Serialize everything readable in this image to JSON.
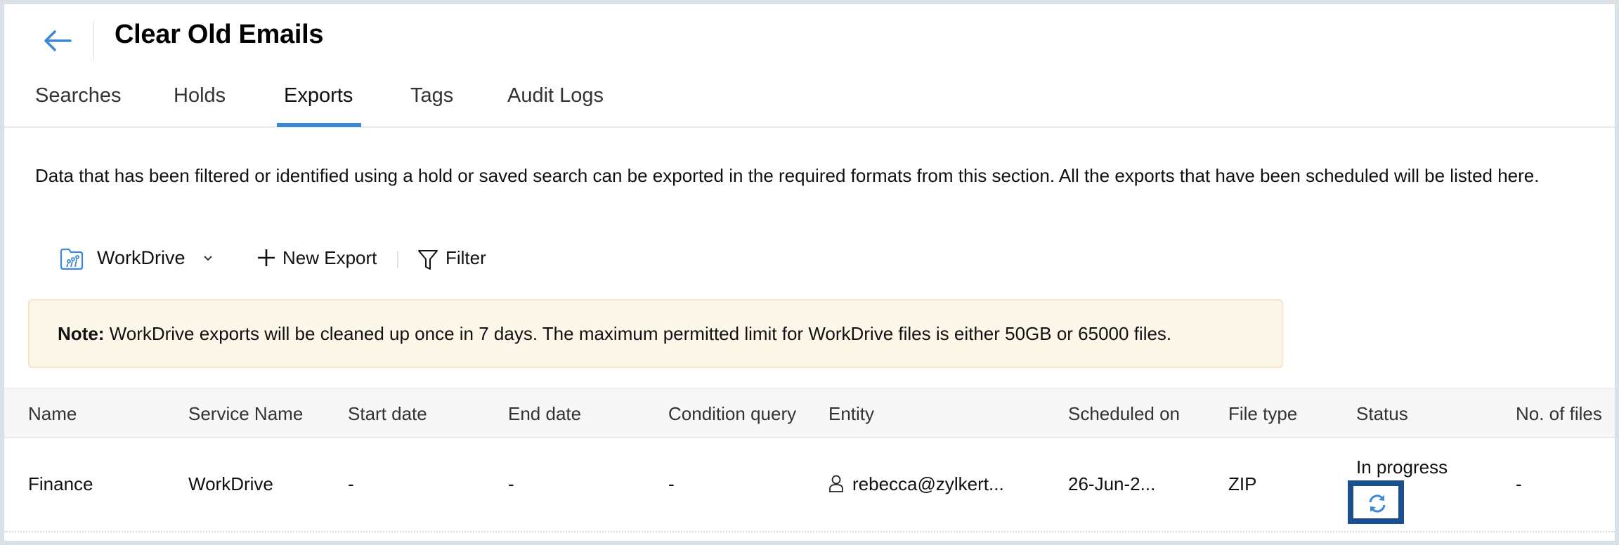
{
  "header": {
    "title": "Clear Old Emails",
    "back_icon": "arrow-left-icon"
  },
  "tabs": [
    {
      "label": "Searches",
      "active": false
    },
    {
      "label": "Holds",
      "active": false
    },
    {
      "label": "Exports",
      "active": true
    },
    {
      "label": "Tags",
      "active": false
    },
    {
      "label": "Audit Logs",
      "active": false
    }
  ],
  "description": "Data that has been filtered or identified using a hold or saved search can be exported in the required formats from this section. All the exports that have been scheduled will be listed here.",
  "toolbar": {
    "workspace_icon": "workdrive-folder-icon",
    "workspace_label": "WorkDrive",
    "new_export_label": "New Export",
    "filter_label": "Filter"
  },
  "note": {
    "prefix": "Note:",
    "text": " WorkDrive exports will be cleaned up once in 7 days. The maximum permitted limit for WorkDrive files is either 50GB or 65000 files."
  },
  "table": {
    "columns": [
      "Name",
      "Service Name",
      "Start date",
      "End date",
      "Condition query",
      "Entity",
      "Scheduled on",
      "File type",
      "Status",
      "No. of files"
    ],
    "rows": [
      {
        "name": "Finance",
        "service_name": "WorkDrive",
        "start_date": "-",
        "end_date": "-",
        "condition_query": "-",
        "entity": "rebecca@zylkert...",
        "scheduled_on": "26-Jun-2...",
        "file_type": "ZIP",
        "status": "In progress",
        "no_of_files": "-"
      }
    ]
  },
  "colors": {
    "accent": "#3d88d4",
    "note_bg": "#fdf7ea",
    "highlight_border": "#1d4f8f"
  }
}
